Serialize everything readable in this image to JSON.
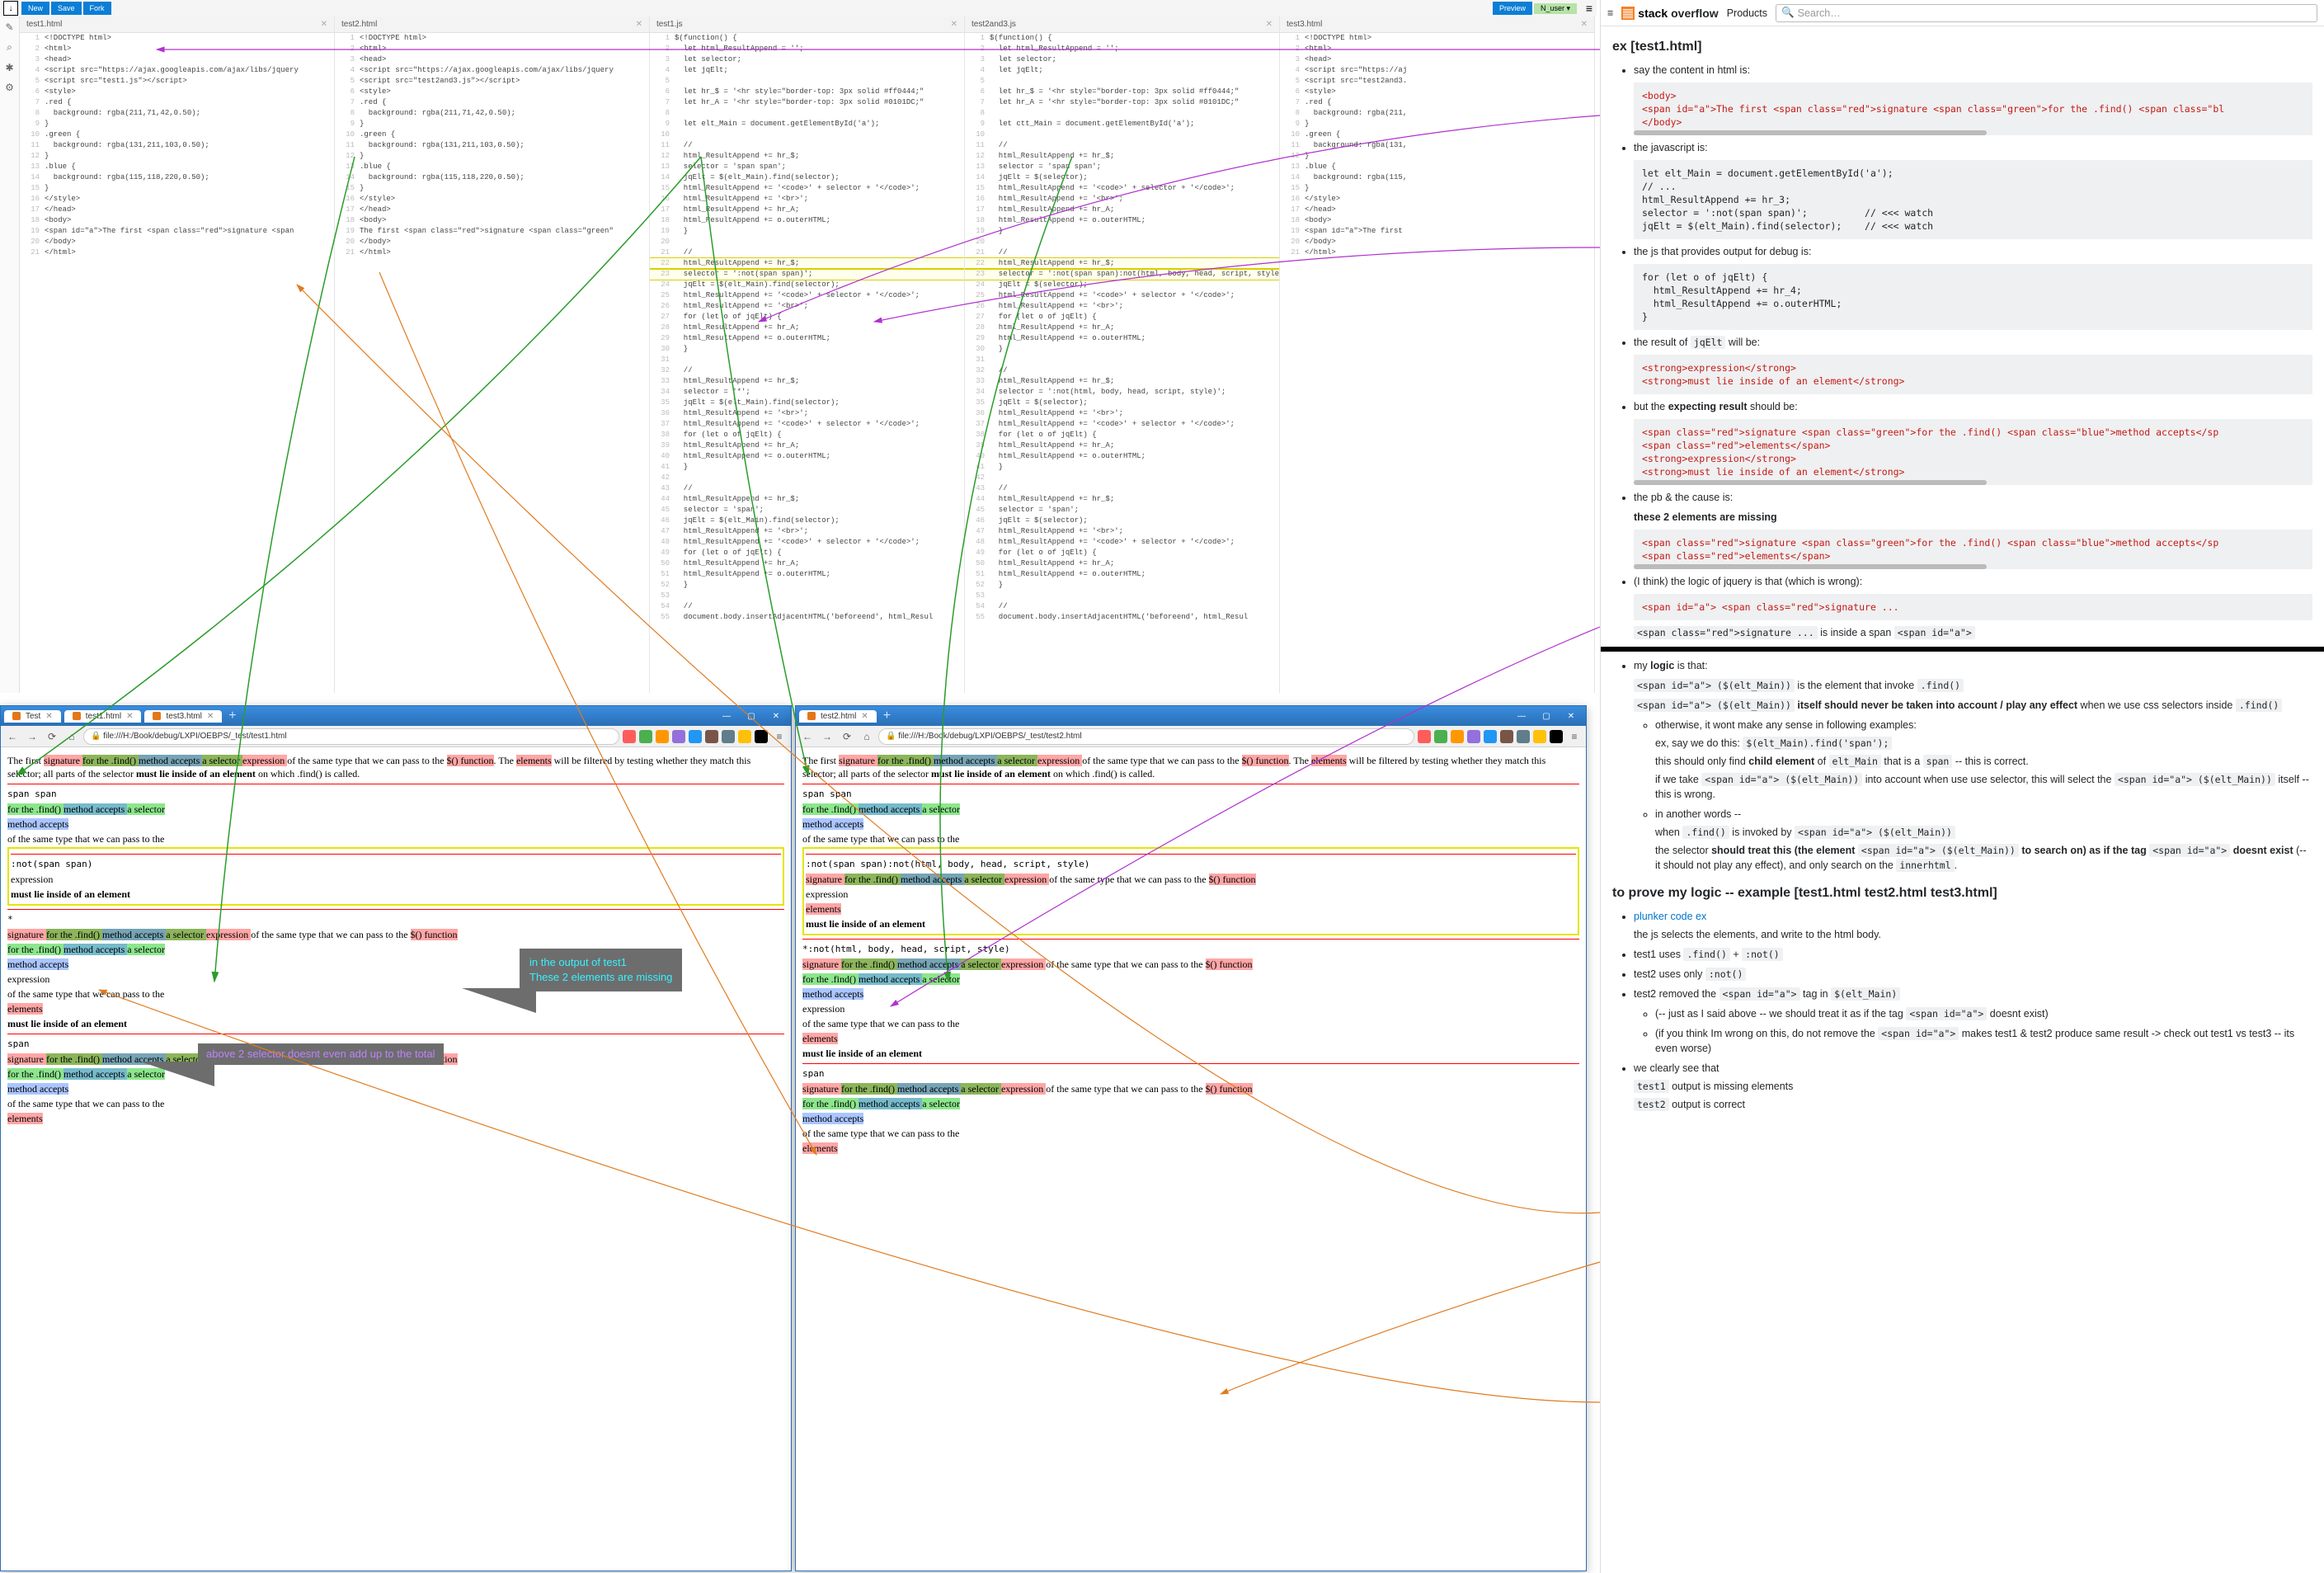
{
  "topbar": {
    "new": "New",
    "save": "Save",
    "fork": "Fork",
    "preview": "Preview",
    "user": "N_user ▾",
    "menu": "≡"
  },
  "sidebar_icons": [
    "✎",
    "⌕",
    "✱",
    "⚙"
  ],
  "panes": [
    {
      "tab": "test1.html",
      "lines": [
        "<!DOCTYPE html>",
        "<html>",
        "<head>",
        "<script src=\"https://ajax.googleapis.com/ajax/libs/jquery",
        "<script src=\"test1.js\"></script>",
        "<style>",
        ".red {",
        "  background: rgba(211,71,42,0.50);",
        "}",
        ".green {",
        "  background: rgba(131,211,103,0.50);",
        "}",
        ".blue {",
        "  background: rgba(115,118,220,0.50);",
        "}",
        "</style>",
        "</head>",
        "<body>",
        "<span id=\"a\">The first <span class=\"red\">signature <span",
        "</body>",
        "</html>"
      ]
    },
    {
      "tab": "test2.html",
      "lines": [
        "<!DOCTYPE html>",
        "<html>",
        "<head>",
        "<script src=\"https://ajax.googleapis.com/ajax/libs/jquery",
        "<script src=\"test2and3.js\"></script>",
        "<style>",
        ".red {",
        "  background: rgba(211,71,42,0.50);",
        "}",
        ".green {",
        "  background: rgba(131,211,103,0.50);",
        "}",
        ".blue {",
        "  background: rgba(115,118,220,0.50);",
        "}",
        "</style>",
        "</head>",
        "<body>",
        "The first <span class=\"red\">signature <span class=\"green\"",
        "</body>",
        "</html>"
      ]
    },
    {
      "tab": "test1.js",
      "lines": [
        "$(function() {",
        "  let html_ResultAppend = '';",
        "  let selector;",
        "  let jqElt;",
        "",
        "  let hr_$ = '<hr style=\"border-top: 3px solid #ff0444;\"",
        "  let hr_A = '<hr style=\"border-top: 3px solid #0101DC;\"",
        "",
        "  let elt_Main = document.getElementById('a');",
        "",
        "  //",
        "  html_ResultAppend += hr_$;",
        "  selector = 'span span';",
        "  jqElt = $(elt_Main).find(selector);",
        "  html_ResultAppend += '<code>' + selector + '</code>';",
        "  html_ResultAppend += '<br>';",
        "  html_ResultAppend += hr_A;",
        "  html_ResultAppend += o.outerHTML;",
        "  }",
        "",
        "  //",
        "  html_ResultAppend += hr_$;",
        "  selector = ':not(span span)';",
        "  jqElt = $(elt_Main).find(selector);",
        "  html_ResultAppend += '<code>' + selector + '</code>';",
        "  html_ResultAppend += '<br>';",
        "  for (let o of jqElt) {",
        "  html_ResultAppend += hr_A;",
        "  html_ResultAppend += o.outerHTML;",
        "  }",
        "",
        "  //",
        "  html_ResultAppend += hr_$;",
        "  selector = '*';",
        "  jqElt = $(elt_Main).find(selector);",
        "  html_ResultAppend += '<br>';",
        "  html_ResultAppend += '<code>' + selector + '</code>';",
        "  for (let o of jqElt) {",
        "  html_ResultAppend += hr_A;",
        "  html_ResultAppend += o.outerHTML;",
        "  }",
        "",
        "  //",
        "  html_ResultAppend += hr_$;",
        "  selector = 'span';",
        "  jqElt = $(elt_Main).find(selector);",
        "  html_ResultAppend += '<br>';",
        "  html_ResultAppend += '<code>' + selector + '</code>';",
        "  for (let o of jqElt) {",
        "  html_ResultAppend += hr_A;",
        "  html_ResultAppend += o.outerHTML;",
        "  }",
        "",
        "  //",
        "  document.body.insertAdjacentHTML('beforeend', html_Resul"
      ],
      "hl": [
        22,
        23
      ]
    },
    {
      "tab": "test2and3.js",
      "lines": [
        "$(function() {",
        "  let html_ResultAppend = '';",
        "  let selector;",
        "  let jqElt;",
        "",
        "  let hr_$ = '<hr style=\"border-top: 3px solid #ff0444;\"",
        "  let hr_A = '<hr style=\"border-top: 3px solid #0101DC;\"",
        "",
        "  let ctt_Main = document.getElementById('a');",
        "",
        "  //",
        "  html_ResultAppend += hr_$;",
        "  selector = 'span span';",
        "  jqElt = $(selector);",
        "  html_ResultAppend += '<code>' + selector + '</code>';",
        "  html_ResultAppend += '<br>';",
        "  html_ResultAppend += hr_A;",
        "  html_ResultAppend += o.outerHTML;",
        "  }",
        "",
        "  //",
        "  html_ResultAppend += hr_$;",
        "  selector = ':not(span span):not(html, body, head, script, style)';",
        "  jqElt = $(selector);",
        "  html_ResultAppend += '<code>' + selector + '</code>';",
        "  html_ResultAppend += '<br>';",
        "  for (let o of jqElt) {",
        "  html_ResultAppend += hr_A;",
        "  html_ResultAppend += o.outerHTML;",
        "  }",
        "",
        "  //",
        "  html_ResultAppend += hr_$;",
        "  selector = ':not(html, body, head, script, style)';",
        "  jqElt = $(selector);",
        "  html_ResultAppend += '<br>';",
        "  html_ResultAppend += '<code>' + selector + '</code>';",
        "  for (let o of jqElt) {",
        "  html_ResultAppend += hr_A;",
        "  html_ResultAppend += o.outerHTML;",
        "  }",
        "",
        "  //",
        "  html_ResultAppend += hr_$;",
        "  selector = 'span';",
        "  jqElt = $(selector);",
        "  html_ResultAppend += '<br>';",
        "  html_ResultAppend += '<code>' + selector + '</code>';",
        "  for (let o of jqElt) {",
        "  html_ResultAppend += hr_A;",
        "  html_ResultAppend += o.outerHTML;",
        "  }",
        "",
        "  //",
        "  document.body.insertAdjacentHTML('beforeend', html_Resul"
      ],
      "hl": [
        22,
        23
      ]
    },
    {
      "tab": "test3.html",
      "lines": [
        "<!DOCTYPE html>",
        "<html>",
        "<head>",
        "<script src=\"https://aj",
        "<script src=\"test2and3.",
        "<style>",
        ".red {",
        "  background: rgba(211,",
        "}",
        ".green {",
        "  background: rgba(131,",
        "}",
        ".blue {",
        "  background: rgba(115,",
        "}",
        "</style>",
        "</head>",
        "<body>",
        "<span id=\"a\">The first",
        "</body>",
        "</html>"
      ]
    }
  ],
  "browser1": {
    "tabs": [
      {
        "t": "Test",
        "active": false
      },
      {
        "t": "test1.html",
        "active": true
      },
      {
        "t": "test3.html",
        "active": false
      }
    ],
    "url": "file:///H:/Book/debug/LXPI/OEBPS/_test/test1.html"
  },
  "browser2": {
    "tabs": [
      {
        "t": "test2.html",
        "active": true
      }
    ],
    "url": "file:///H:/Book/debug/LXPI/OEBPS/_test/test2.html"
  },
  "content_top": "The first signature for the .find() method accepts a selector expression of the same type that we can pass to the $() function. The elements will be filtered by testing whether they match this selector; all parts of the selector must lie inside of an element on which .find() is called.",
  "seg": {
    "sig": "signature ",
    "for": "for the .find() ",
    "method": "method accepts ",
    "asel": "a selector ",
    "expr": "expression ",
    "same": "of the same type that we can pass to the ",
    "fn": "$() function",
    "elem": "elements",
    "mustlie": "must lie inside of an element"
  },
  "labels": {
    "span_span": "span span",
    "not1": ":not(span span)",
    "not2": ":not(span span):not(html, body, head, script, style)",
    "star_not": "*:not(html, body, head, script, style)",
    "star": "*",
    "span": "span",
    "expression": "expression",
    "mustlie": "must lie inside of an element"
  },
  "callout": {
    "l1": "in the output of test1",
    "l2": "These 2 elements are missing",
    "l3": "above 2 selector doesnt even add up to the total"
  },
  "so": {
    "products": "Products",
    "search_ph": "Search…",
    "h_ex": "ex [test1.html]",
    "li1": "say the content in html is:",
    "cb1": "<body>\n<span id=\"a\">The first <span class=\"red\">signature <span class=\"green\">for the .find() <span class=\"bl\n</body>",
    "li2": "the javascript is:",
    "cb2": "let elt_Main = document.getElementById('a');\n// ...\nhtml_ResultAppend += hr_3;\nselector = ':not(span span)';          // <<< watch\njqElt = $(elt_Main).find(selector);    // <<< watch",
    "li3": "the js that provides output for debug is:",
    "cb3": "for (let o of jqElt) {\n  html_ResultAppend += hr_4;\n  html_ResultAppend += o.outerHTML;\n}",
    "li4_a": "the result of ",
    "li4_b": " will be:",
    "cb4": "<strong>expression</strong>\n<strong>must lie inside of an element</strong>",
    "li5_a": "but the ",
    "li5_b": "expecting result",
    "li5_c": " should be:",
    "cb5": "<span class=\"red\">signature <span class=\"green\">for the .find() <span class=\"blue\">method accepts</sp\n<span class=\"red\">elements</span>\n<strong>expression</strong>\n<strong>must lie inside of an element</strong>",
    "li6": "the pb & the cause is:",
    "li6b": "these 2 elements are missing",
    "cb6": "<span class=\"red\">signature <span class=\"green\">for the .find() <span class=\"blue\">method accepts</sp\n<span class=\"red\">elements</span>",
    "li7": "(I think) the logic of jquery is that (which is wrong):",
    "cb7": "<span id=\"a\"> <span class=\"red\">signature ...",
    "li7b_a": "<span class=\"red\">signature ...",
    "li7b_b": " is inside a span ",
    "li7b_c": "<span id=\"a\">",
    "li8_a": "my ",
    "li8_b": "logic",
    "li8_c": " is that:",
    "li8_1_b": " is the element that invoke ",
    "li8_2_b": " itself should never be taken into account / play any effect",
    "li8_2_c": " when we use css selectors inside ",
    "li8_3": "otherwise, it wont make any sense in following examples:",
    "li8_4_a": "ex, say we do this: ",
    "li8_5_a": "this should only find ",
    "li8_5_b": "child element",
    "li8_5_c": " of ",
    "li8_5_d": " that is a ",
    "li8_5_e": " -- this is correct.",
    "li8_6_a": "if we take ",
    "li8_6_b": " into account when use use selector, this will select the ",
    "li8_6_c": " itself -- this is wrong.",
    "li8_7": "in another words --",
    "li8_8_a": "when ",
    "li8_8_b": " is invoked by ",
    "li8_9_a": "the selector ",
    "li8_9_b": "should treat this (the element ",
    "li8_9_c": " to search on) as if the tag ",
    "li8_9_d": " doesnt exist",
    "li8_9_e": " (-- it should not play any effect), and only search on the ",
    "h2": "to prove my logic -- example [test1.html test2.html test3.html]",
    "plnk": "plunker code ex",
    "li_p1": "the js selects the elements, and write to the html body.",
    "li_p2_a": "test1 uses ",
    "li_p2_b": " + ",
    "li_p3_a": "test2 uses only ",
    "li_p4_a": "test2 ",
    "li_p4_b": "removed the ",
    "li_p4_c": " tag in ",
    "li_p5_a": "(-- just as I said above -- we should treat it as if the tag ",
    "li_p5_b": " doesnt exist)",
    "li_p6_a": "(if you think Im wrong on this, do not remove the ",
    "li_p6_b": " makes test1 & test2 produce same result -> check out test1 vs test3 -- its even worse)",
    "li_p7": "we clearly see that",
    "li_p8_b": " output is missing elements",
    "li_p9_b": " output is correct",
    "code": {
      "jqElt": "jqElt",
      "find": ".find()",
      "span_a": "<span id=\"a\"> ($(elt_Main))",
      "span_a2": "<span id=\"a\">",
      "elt_find_span": "$(elt_Main).find('span');",
      "elt_main": "elt_Main",
      "span": "span",
      "not": ":not()",
      "innerhtml": "innerhtml",
      "test1": "test1",
      "test2": "test2",
      "eltm": "$(elt_Main)"
    }
  }
}
